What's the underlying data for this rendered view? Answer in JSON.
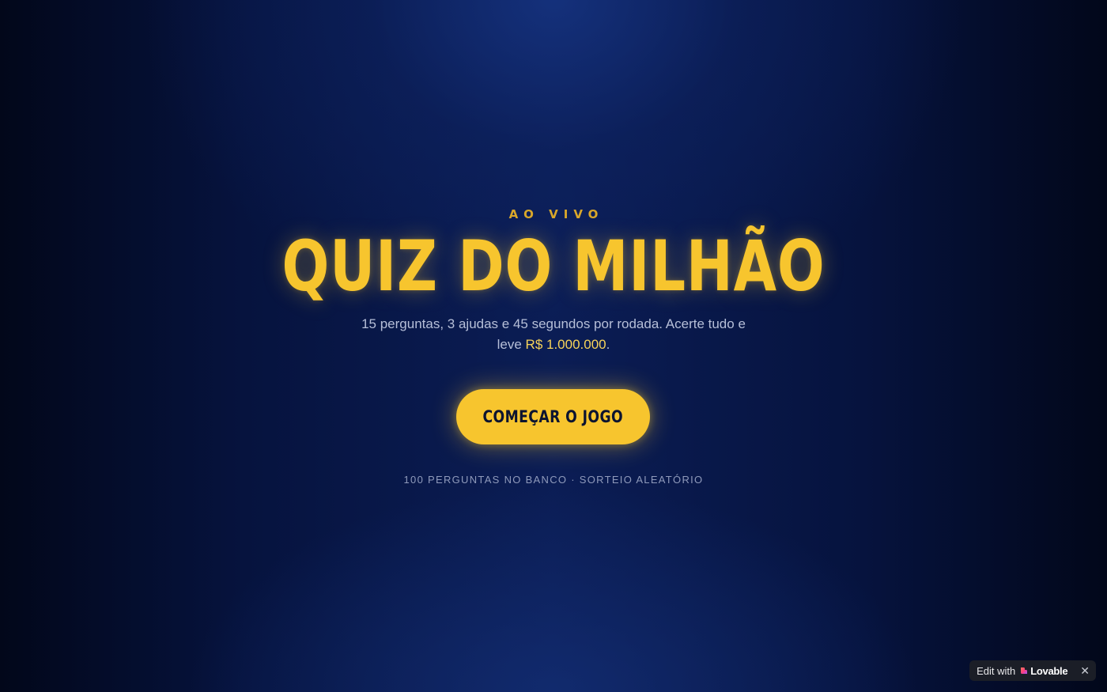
{
  "hero": {
    "eyebrow": "AO VIVO",
    "title": "QUIZ DO MILHÃO",
    "subtitle_before": "15 perguntas, 3 ajudas e 45 segundos por rodada. Acerte tudo e leve ",
    "subtitle_prize": "R$ 1.000.000",
    "subtitle_after": ".",
    "cta_label": "COMEÇAR O JOGO",
    "footnote": "100 PERGUNTAS NO BANCO · SORTEIO ALEATÓRIO"
  },
  "badge": {
    "prefix": "Edit with",
    "brand": "Lovable",
    "close_glyph": "✕"
  },
  "colors": {
    "accent": "#f7c52e",
    "background": "#030a24",
    "text_muted": "#b6bfd8"
  },
  "icons": {
    "brand_logo": "lovable-heart-icon",
    "close": "close-icon"
  }
}
